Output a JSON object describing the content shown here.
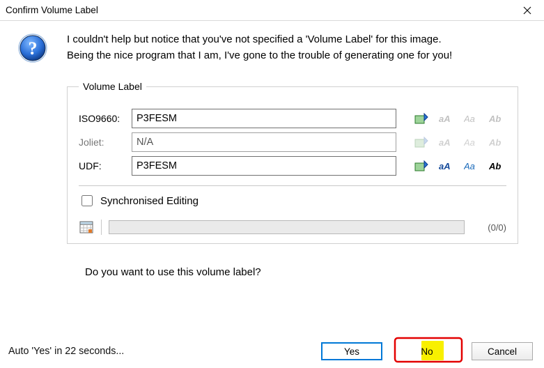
{
  "title": "Confirm Volume Label",
  "message_line1": "I couldn't help but notice that you've not specified a 'Volume Label' for this image.",
  "message_line2": "Being the nice program that I am, I've gone to the trouble of generating one for you!",
  "group": {
    "legend": "Volume Label",
    "iso9660_label": "ISO9660:",
    "iso9660_value": "P3FESM",
    "joliet_label": "Joliet:",
    "joliet_value": "N/A",
    "udf_label": "UDF:",
    "udf_value": "P3FESM",
    "sync_label": "Synchronised Editing",
    "progress_count": "(0/0)"
  },
  "prompt": "Do you want to use this volume label?",
  "auto_text": "Auto 'Yes' in 22 seconds...",
  "buttons": {
    "yes": "Yes",
    "no": "No",
    "cancel": "Cancel"
  }
}
